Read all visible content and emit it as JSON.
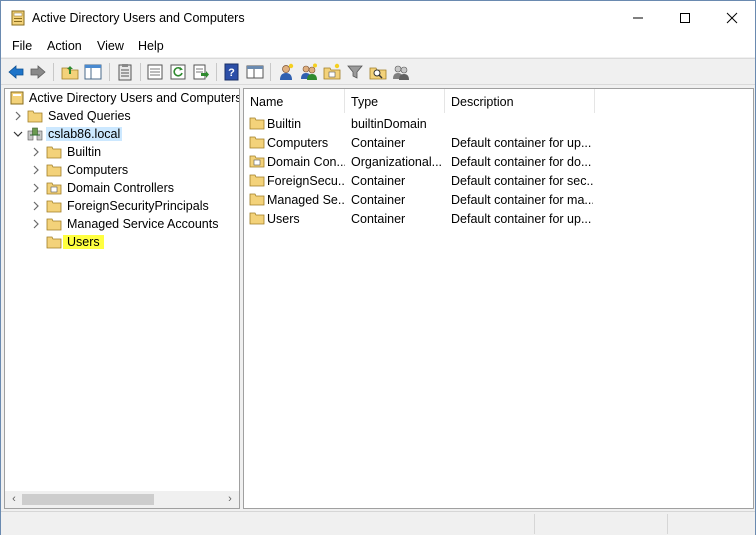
{
  "window": {
    "title": "Active Directory Users and Computers",
    "controls": {
      "minimize": "minimize-icon",
      "maximize": "maximize-icon",
      "close": "close-icon"
    }
  },
  "menu": [
    "File",
    "Action",
    "View",
    "Help"
  ],
  "toolbar": {
    "icons": [
      "back-icon",
      "forward-icon",
      "up-folder-icon",
      "show-hide-tree-icon",
      "clipboard-icon",
      "properties-icon",
      "refresh-icon",
      "export-list-icon",
      "help-icon",
      "view-icon",
      "new-user-icon",
      "new-group-icon",
      "new-ou-icon",
      "filter-icon",
      "find-icon",
      "add-to-group-icon"
    ]
  },
  "tree": {
    "root_label": "Active Directory Users and Computers [\\",
    "items": [
      {
        "label": "Saved Queries",
        "level": 1,
        "expander": "chevron-right"
      },
      {
        "label": "cslab86.local",
        "level": 1,
        "expander": "chevron-down",
        "selected": true
      },
      {
        "label": "Builtin",
        "level": 2,
        "expander": "chevron-right"
      },
      {
        "label": "Computers",
        "level": 2,
        "expander": "chevron-right"
      },
      {
        "label": "Domain Controllers",
        "level": 2,
        "expander": "chevron-right"
      },
      {
        "label": "ForeignSecurityPrincipals",
        "level": 2,
        "expander": "chevron-right"
      },
      {
        "label": "Managed Service Accounts",
        "level": 2,
        "expander": "chevron-right"
      },
      {
        "label": "Users",
        "level": 2,
        "expander": "",
        "highlighted": true
      }
    ]
  },
  "list": {
    "columns": [
      "Name",
      "Type",
      "Description"
    ],
    "rows": [
      {
        "name": "Builtin",
        "type": "builtinDomain",
        "description": ""
      },
      {
        "name": "Computers",
        "type": "Container",
        "description": "Default container for up..."
      },
      {
        "name": "Domain Con...",
        "type": "Organizational...",
        "description": "Default container for do..."
      },
      {
        "name": "ForeignSecu...",
        "type": "Container",
        "description": "Default container for sec..."
      },
      {
        "name": "Managed Se...",
        "type": "Container",
        "description": "Default container for ma..."
      },
      {
        "name": "Users",
        "type": "Container",
        "description": "Default container for up..."
      }
    ]
  },
  "colors": {
    "selection": "#cce8ff",
    "highlight": "#ffff40",
    "folder": "#f3d27a"
  }
}
